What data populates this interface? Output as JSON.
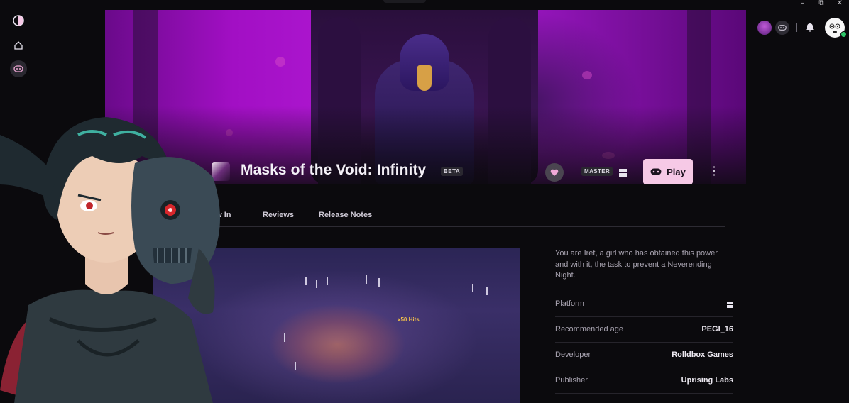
{
  "window": {
    "controls": [
      "–",
      "⧉",
      "✕"
    ]
  },
  "sidebar": {
    "items": [
      {
        "icon": "app-logo-icon"
      },
      {
        "icon": "home-icon"
      },
      {
        "icon": "gamepad-icon",
        "active": true
      }
    ]
  },
  "topbar": {
    "icons": [
      "profile-avatar-icon",
      "gamepad-icon",
      "bell-icon",
      "user-avatar-icon"
    ]
  },
  "game": {
    "title": "Masks of the Void: Infinity",
    "badge": "BETA",
    "branch": "MASTER",
    "play_label": "Play",
    "accent": "#f6c9e6"
  },
  "tabs": [
    {
      "label": "ew In"
    },
    {
      "label": "Reviews"
    },
    {
      "label": "Release Notes"
    }
  ],
  "media": {
    "hud_hits": "x50 Hits"
  },
  "info": {
    "description": "You are Iret, a girl who has obtained this power and with it, the task to prevent a Neverending Night.",
    "rows": [
      {
        "key": "Platform",
        "value": ""
      },
      {
        "key": "Recommended age",
        "value": "PEGI_16"
      },
      {
        "key": "Developer",
        "value": "Rolldbox Games"
      },
      {
        "key": "Publisher",
        "value": "Uprising Labs"
      }
    ]
  }
}
